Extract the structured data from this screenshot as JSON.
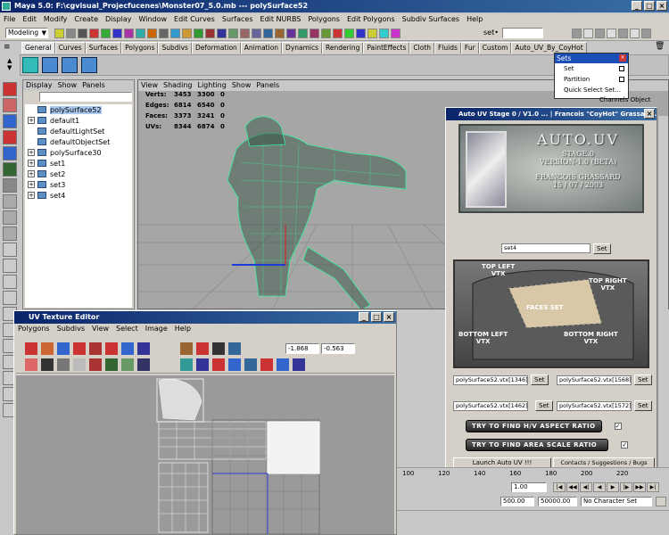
{
  "main_window": {
    "title": "Maya 5.0: F:\\cgvisual_Projecfucenes\\Monster07_5.0.mb   ---   polySurface52",
    "menus": [
      "File",
      "Edit",
      "Modify",
      "Create",
      "Display",
      "Window",
      "Edit Curves",
      "Surfaces",
      "Edit NURBS",
      "Polygons",
      "Edit Polygons",
      "Subdiv Surfaces",
      "Help"
    ],
    "mode_select": "Modeling",
    "set_label": "set•",
    "shelf_tabs": [
      "General",
      "Curves",
      "Surfaces",
      "Polygons",
      "Subdivs",
      "Deformation",
      "Animation",
      "Dynamics",
      "Rendering",
      "PaintEffects",
      "Cloth",
      "Fluids",
      "Fur",
      "Custom",
      "Auto_UV_By_CoyHot"
    ]
  },
  "sets_popup": {
    "title": "Sets",
    "items": [
      "Set",
      "Partition",
      "Quick Select Set..."
    ]
  },
  "channel_hint": "Channels  Object",
  "outliner": {
    "menus": [
      "Display",
      "Show",
      "Panels"
    ],
    "items": [
      {
        "label": "polySurface52",
        "expand": false,
        "selected": true
      },
      {
        "label": "default1",
        "expand": true,
        "selected": false
      },
      {
        "label": "defaultLightSet",
        "expand": false,
        "selected": false
      },
      {
        "label": "defaultObjectSet",
        "expand": false,
        "selected": false
      },
      {
        "label": "polySurface30",
        "expand": true,
        "selected": false
      },
      {
        "label": "set1",
        "expand": true,
        "selected": false
      },
      {
        "label": "set2",
        "expand": true,
        "selected": false
      },
      {
        "label": "set3",
        "expand": true,
        "selected": false
      },
      {
        "label": "set4",
        "expand": true,
        "selected": false
      }
    ]
  },
  "viewport": {
    "menus": [
      "View",
      "Shading",
      "Lighting",
      "Show",
      "Panels"
    ],
    "hud": [
      {
        "label": "Verts:",
        "a": "3453",
        "b": "3300",
        "c": "0"
      },
      {
        "label": "Edges:",
        "a": "6814",
        "b": "6540",
        "c": "0"
      },
      {
        "label": "Faces:",
        "a": "3373",
        "b": "3241",
        "c": "0"
      },
      {
        "label": "UVs:",
        "a": "8344",
        "b": "6874",
        "c": "0"
      }
    ]
  },
  "auto_uv": {
    "title": "Auto UV Stage 0 / V1.0 ...   | Francois \"CoyHot\" Grassard ...",
    "banner": {
      "line1": "AUTO.UV",
      "line2": "STAGE.0",
      "line3": "VERSION-1.0 (BETA)",
      "line4": "FRANCOIS GRASSARD",
      "line5": "15 / 07 / 2003"
    },
    "set_field": "set4",
    "set_button": "Set",
    "diagram_labels": {
      "top_left": "TOP LEFT\nVTX",
      "top_right": "TOP RIGHT\nVTX",
      "faces_set": "FACES SET",
      "bottom_left": "BOTTOM LEFT\nVTX",
      "bottom_right": "BOTTOM RIGHT\nVTX"
    },
    "vtx_fields": [
      {
        "value": "polySurface52.vtx[1346]"
      },
      {
        "value": "polySurface52.vtx[1568]"
      },
      {
        "value": "polySurface52.vtx[1462]"
      },
      {
        "value": "polySurface52.vtx[1572]"
      }
    ],
    "try_aspect": "TRY TO FIND H/V ASPECT RATIO",
    "try_area": "TRY TO FIND AREA SCALE RATIO",
    "check": "✓",
    "launch": "Launch Auto UV !!!",
    "contacts": "Contacts / Suggestions / Bugs Reports"
  },
  "uv_editor": {
    "title": "UV Texture Editor",
    "menus": [
      "Polygons",
      "Subdivs",
      "View",
      "Select",
      "Image",
      "Help"
    ],
    "u_value": "-1.868",
    "v_value": "-0.563"
  },
  "timeline": {
    "ticks": [
      "100",
      "120",
      "140",
      "160",
      "180",
      "200",
      "220"
    ],
    "current": "1.00",
    "range_a": "500.00",
    "range_b": "50000.00",
    "character": "No Character Set"
  },
  "colors": {
    "title_blue": "#0a246a",
    "viewport_bg": "#a6a6a6",
    "mesh_green": "#3cf0a0",
    "uv_bg": "#9a9a9a",
    "timeline_tick": "#000000"
  }
}
